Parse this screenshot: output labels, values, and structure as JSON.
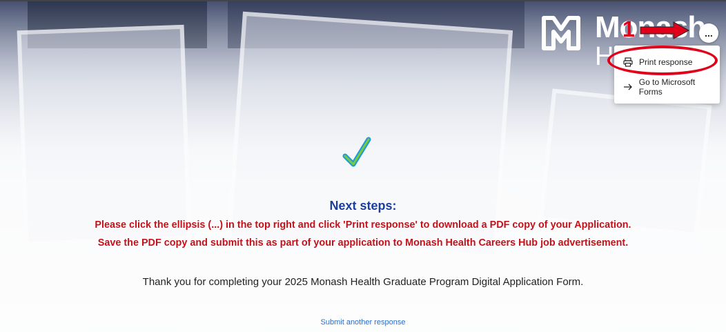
{
  "logo": {
    "line1": "Monash",
    "line2": "Health"
  },
  "more_button": {
    "label": "..."
  },
  "menu": {
    "items": [
      {
        "label": "Print response",
        "icon": "printer-icon"
      },
      {
        "label": "Go to Microsoft Forms",
        "icon": "arrow-right-icon"
      }
    ]
  },
  "annotation": {
    "number": "1",
    "color": "#e0001a"
  },
  "content": {
    "heading": "Next steps:",
    "instruction_line1": "Please click the ellipsis (...) in the top right and click 'Print response' to download a PDF copy of your Application.",
    "instruction_line2": "Save the PDF copy and submit this as part of your application to Monash Health Careers Hub job advertisement.",
    "thanks": "Thank you for completing your 2025 Monash Health Graduate Program Digital Application Form.",
    "submit_another": "Submit another response"
  },
  "colors": {
    "heading": "#1a3f9c",
    "instruction": "#c4121a",
    "link": "#2b6cc4"
  }
}
